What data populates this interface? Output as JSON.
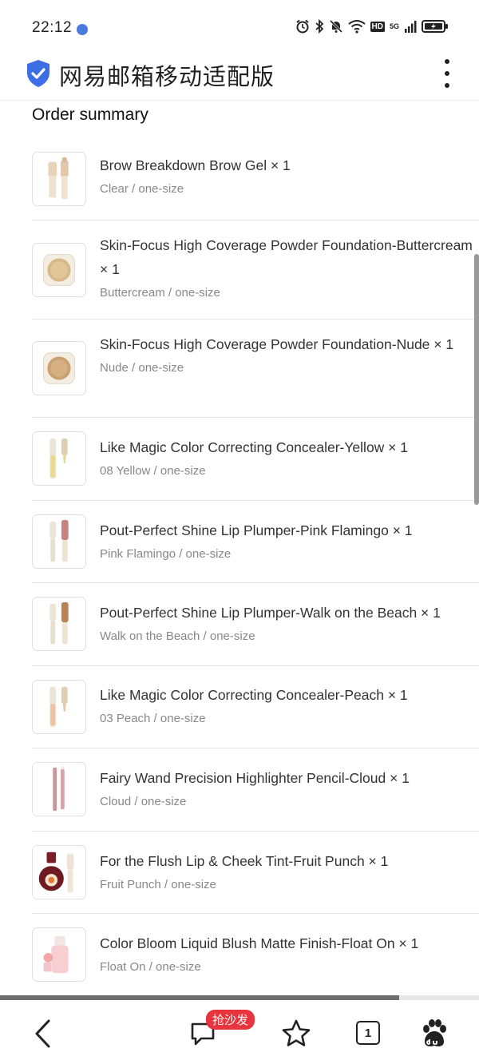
{
  "status": {
    "time": "22:12",
    "net_hd": "HD",
    "net_gen": "5G"
  },
  "header": {
    "title": "网易邮箱移动适配版"
  },
  "order": {
    "title": "Order summary",
    "items": [
      {
        "name": "Brow Breakdown Brow Gel × 1",
        "variant": "Clear / one-size",
        "icon": "brow-gel-tube-icon"
      },
      {
        "name": "Skin-Focus High Coverage Powder Foundation-Buttercream × 1",
        "variant": "Buttercream / one-size",
        "icon": "powder-compact-icon"
      },
      {
        "name": "Skin-Focus High Coverage Powder Foundation-Nude × 1",
        "variant": "Nude / one-size",
        "icon": "powder-compact-icon"
      },
      {
        "name": "Like Magic Color Correcting Concealer-Yellow × 1",
        "variant": "08 Yellow / one-size",
        "icon": "concealer-wand-icon"
      },
      {
        "name": "Pout-Perfect Shine Lip Plumper-Pink Flamingo × 1",
        "variant": "Pink Flamingo / one-size",
        "icon": "lip-plumper-icon"
      },
      {
        "name": "Pout-Perfect Shine Lip Plumper-Walk on the Beach × 1",
        "variant": "Walk on the Beach / one-size",
        "icon": "lip-plumper-icon"
      },
      {
        "name": "Like Magic Color Correcting Concealer-Peach × 1",
        "variant": "03 Peach / one-size",
        "icon": "concealer-wand-icon"
      },
      {
        "name": "Fairy Wand Precision Highlighter Pencil-Cloud × 1",
        "variant": "Cloud / one-size",
        "icon": "highlighter-pencil-icon"
      },
      {
        "name": "For the Flush Lip & Cheek Tint-Fruit Punch × 1",
        "variant": "Fruit Punch / one-size",
        "icon": "tint-bottle-icon"
      },
      {
        "name": "Color Bloom Liquid Blush Matte Finish-Float On × 1",
        "variant": "Float On / one-size",
        "icon": "liquid-blush-icon"
      }
    ]
  },
  "browser": {
    "page_load_progress": 0.833,
    "sofa_badge": "抢沙发",
    "tab_count": "1"
  },
  "colors": {
    "accent_blue": "#3d6ee6",
    "badge_red": "#e8343c"
  }
}
